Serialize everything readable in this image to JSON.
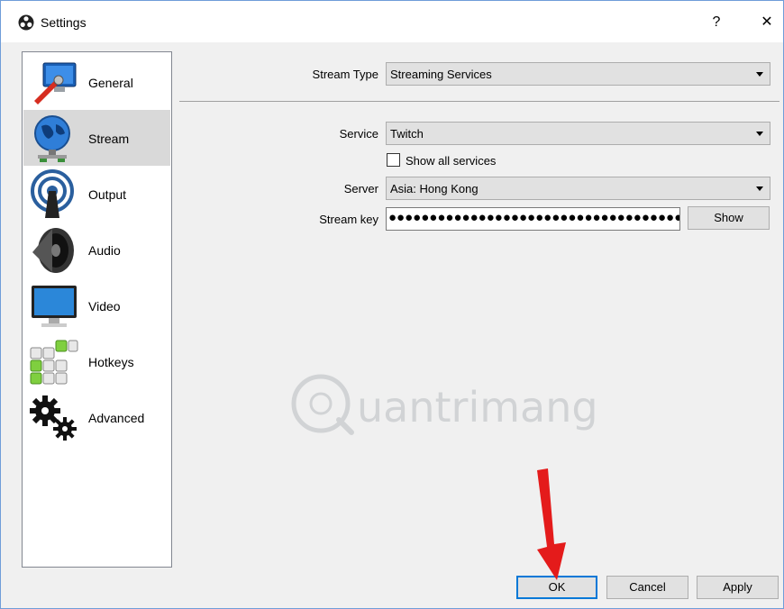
{
  "window": {
    "title": "Settings",
    "help_label": "?",
    "close_label": "✕"
  },
  "sidebar": {
    "items": [
      {
        "label": "General"
      },
      {
        "label": "Stream"
      },
      {
        "label": "Output"
      },
      {
        "label": "Audio"
      },
      {
        "label": "Video"
      },
      {
        "label": "Hotkeys"
      },
      {
        "label": "Advanced"
      }
    ],
    "selected": "Stream"
  },
  "stream": {
    "stream_type_label": "Stream Type",
    "stream_type_value": "Streaming Services",
    "service_label": "Service",
    "service_value": "Twitch",
    "show_all_label": "Show all services",
    "show_all_checked": false,
    "server_label": "Server",
    "server_value": "Asia: Hong Kong",
    "key_label": "Stream key",
    "key_value": "●●●●●●●●●●●●●●●●●●●●●●●●●●●●●●●●●●●●●●●",
    "show_button": "Show"
  },
  "footer": {
    "ok_label": "OK",
    "cancel_label": "Cancel",
    "apply_label": "Apply"
  },
  "watermark": {
    "text": "uantrimang"
  },
  "colors": {
    "annotation_arrow": "#e41b1b",
    "focus_border": "#0078d7",
    "selected_bg": "#d9d9d9"
  }
}
